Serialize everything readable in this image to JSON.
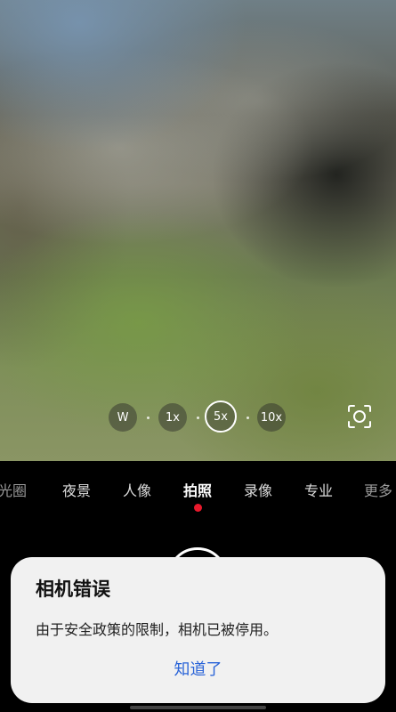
{
  "camera": {
    "zoom_levels": [
      {
        "label": "W",
        "active": false
      },
      {
        "label": "1x",
        "active": false
      },
      {
        "label": "5x",
        "active": true
      },
      {
        "label": "10x",
        "active": false
      }
    ],
    "scan_icon": "scan-icon",
    "modes": [
      {
        "label": "光圈",
        "active": false
      },
      {
        "label": "夜景",
        "active": false
      },
      {
        "label": "人像",
        "active": false
      },
      {
        "label": "拍照",
        "active": true
      },
      {
        "label": "录像",
        "active": false
      },
      {
        "label": "专业",
        "active": false
      },
      {
        "label": "更多",
        "active": false
      }
    ],
    "indicator_color": "#e8192c"
  },
  "dialog": {
    "title": "相机错误",
    "message": "由于安全政策的限制，相机已被停用。",
    "button_label": "知道了",
    "button_color": "#2a64d8"
  }
}
